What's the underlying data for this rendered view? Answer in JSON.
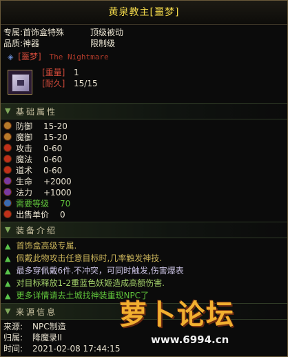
{
  "title": "黄泉教主[噩梦]",
  "header_rows": {
    "exclusive_label": "专属:",
    "exclusive_value": "首饰盒特殊",
    "exclusive_extra": "顶级被动",
    "quality_label": "品质:",
    "quality_value": "神器",
    "quality_extra": "限制级",
    "tag_cn": "[噩梦]",
    "tag_en": "The Nightmare"
  },
  "item": {
    "weight_label": "[重量]",
    "weight_value": "1",
    "durability_label": "[耐久]",
    "durability_value": "15/15"
  },
  "section_basic": "基础属性",
  "stats": [
    {
      "name": "防御",
      "value": "15-20",
      "icon_color": "#b87a2a"
    },
    {
      "name": "魔御",
      "value": "15-20",
      "icon_color": "#b87a2a"
    },
    {
      "name": "攻击",
      "value": "0-60",
      "icon_color": "#c0301a"
    },
    {
      "name": "魔法",
      "value": "0-60",
      "icon_color": "#c0301a"
    },
    {
      "name": "道术",
      "value": "0-60",
      "icon_color": "#c0301a"
    },
    {
      "name": "生命",
      "value": "+2000",
      "icon_color": "#7a3aa0"
    },
    {
      "name": "法力",
      "value": "+1000",
      "icon_color": "#7a3aa0"
    },
    {
      "name": "需要等级",
      "value": "70",
      "icon_color": "#3a6ab0"
    },
    {
      "name": "出售单价",
      "value": "0",
      "icon_color": "#c0301a"
    }
  ],
  "section_equip": "装备介绍",
  "descriptions": [
    "首饰盒高级专属.",
    "佩戴此物攻击任意目标时,几率触发神技.",
    "最多穿佩戴6件.不冲突，可同时触发,伤害爆表",
    "对目标释放1-2重蓝色妖姬造成高额伤害.",
    "更多详情请去土城找神装重现NPC了"
  ],
  "section_source": "来源信息",
  "source": {
    "from_label": "来源:",
    "from_value": "NPC制造",
    "owner_label": "归属:",
    "owner_value": "降魔录II",
    "time_label": "时间:",
    "time_value": "2021-02-08 17:44:15"
  },
  "watermark": {
    "text": "萝卜论坛",
    "url": "www.6994.cn"
  },
  "colors": {
    "title_gold": "#f2d84a",
    "red_label": "#d24a3a",
    "green_text": "#5fc23a",
    "desc_gold": "#c9b35a"
  }
}
